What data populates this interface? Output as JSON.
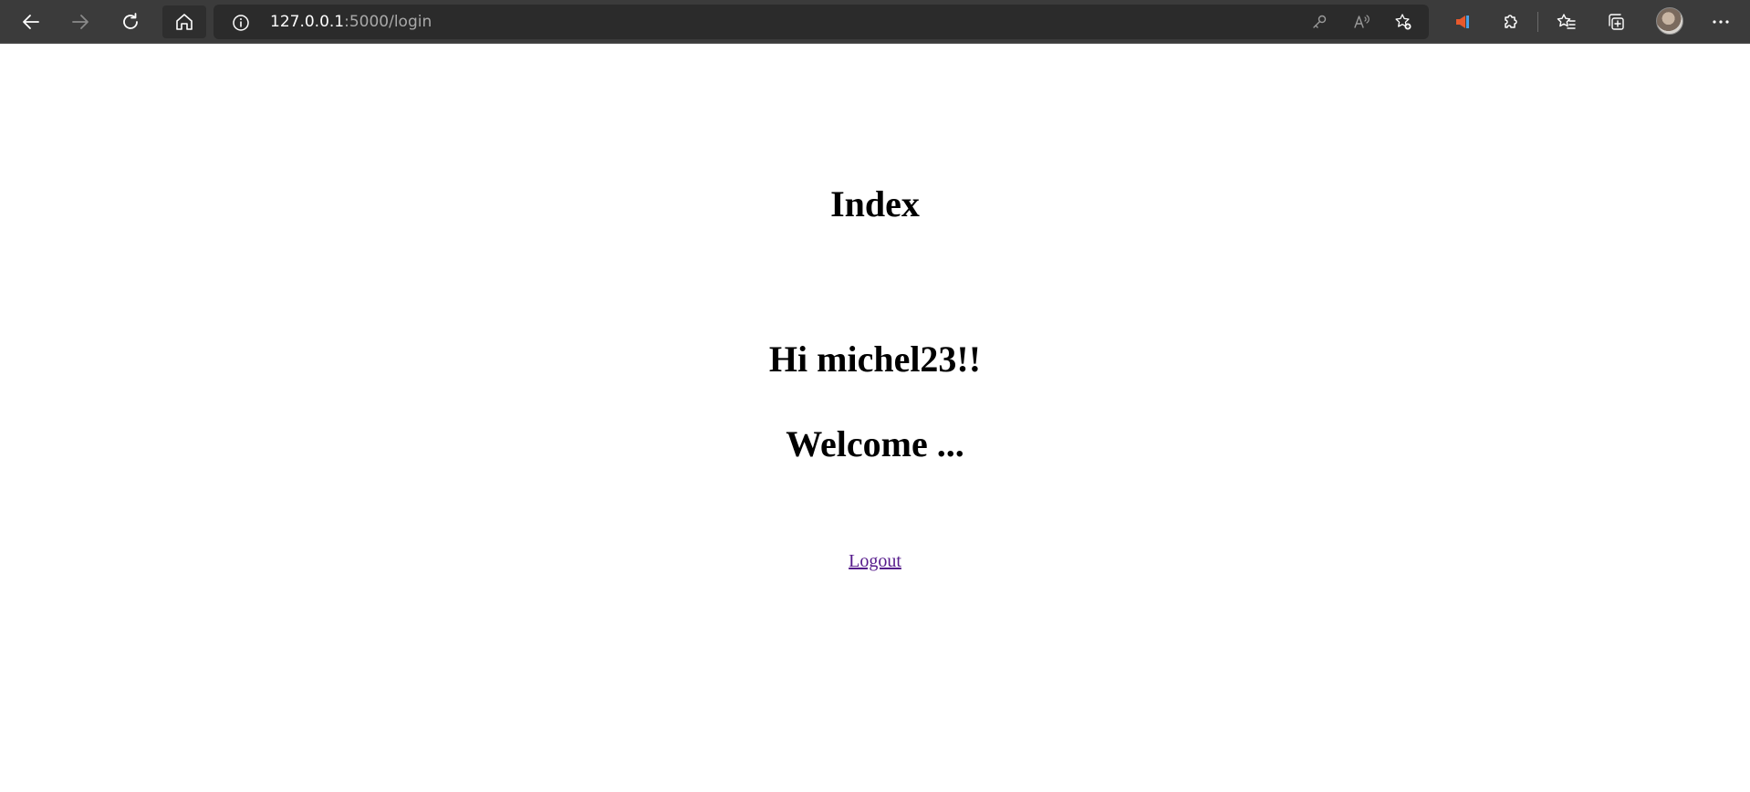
{
  "browser": {
    "address": {
      "host": "127.0.0.1",
      "path": ":5000/login"
    },
    "buttons": {
      "back": "back-arrow-icon",
      "forward": "forward-arrow-icon",
      "refresh": "refresh-icon",
      "home": "home-icon"
    },
    "colors": {
      "toolbar_bg": "#3b3b3b",
      "address_bg": "#2b2b2b",
      "url_host": "#ffffff",
      "url_path": "#a9a9a9"
    }
  },
  "page": {
    "title": "Index",
    "greeting": "Hi michel23!!",
    "welcome": "Welcome ...",
    "logout_label": "Logout",
    "link_color": "#551a8b"
  }
}
